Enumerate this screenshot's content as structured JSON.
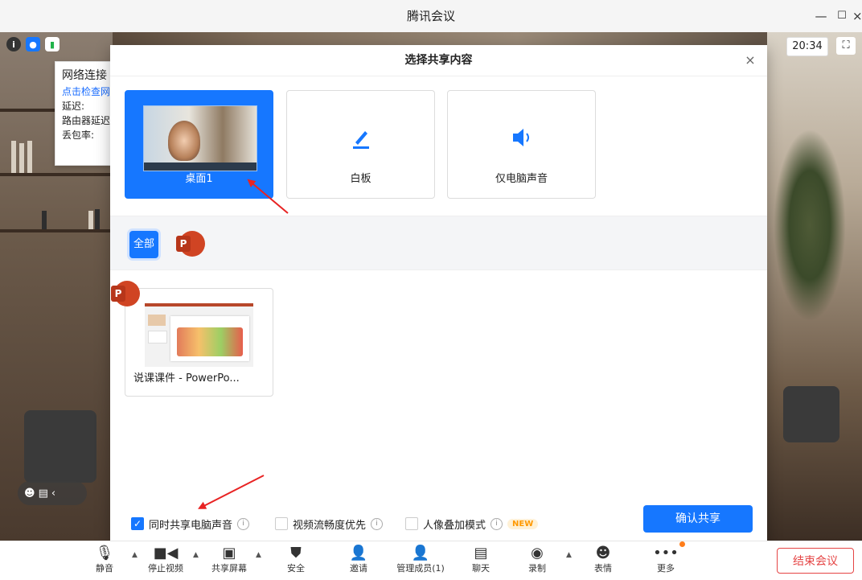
{
  "window": {
    "title": "腾讯会议",
    "minimize": "—",
    "maximize": "☐",
    "close": "×"
  },
  "network_popup": {
    "title": "网络连接",
    "link": "点击检查网",
    "latency": "延迟:",
    "router_latency": "路由器延迟",
    "packet_loss": "丢包率:"
  },
  "clock": "20:34",
  "dialog": {
    "title": "选择共享内容",
    "close": "×",
    "cards": [
      {
        "label": "桌面1",
        "icon": "desktop-thumbnail",
        "selected": true
      },
      {
        "label": "白板",
        "icon": "pen-icon",
        "selected": false
      },
      {
        "label": "仅电脑声音",
        "icon": "speaker-icon",
        "selected": false
      }
    ],
    "filter_all": "全部",
    "ppt_badge": "P",
    "app_card_label": "说课课件 - PowerPo...",
    "options": [
      {
        "label": "同时共享电脑声音",
        "checked": true
      },
      {
        "label": "视频流畅度优先",
        "checked": false
      },
      {
        "label": "人像叠加模式",
        "checked": false,
        "tag": "NEW"
      }
    ],
    "confirm": "确认共享"
  },
  "toolbar": {
    "items": [
      {
        "label": "静音",
        "icon": "mic-icon"
      },
      {
        "label": "停止视频",
        "icon": "camera-icon"
      },
      {
        "label": "共享屏幕",
        "icon": "share-screen-icon"
      },
      {
        "label": "安全",
        "icon": "shield-icon"
      },
      {
        "label": "邀请",
        "icon": "invite-icon"
      },
      {
        "label": "管理成员(1)",
        "icon": "members-icon"
      },
      {
        "label": "聊天",
        "icon": "chat-icon"
      },
      {
        "label": "录制",
        "icon": "record-icon"
      },
      {
        "label": "表情",
        "icon": "emoji-icon"
      },
      {
        "label": "更多",
        "icon": "more-icon"
      }
    ],
    "end_meeting": "结束会议"
  },
  "colors": {
    "accent": "#1677ff",
    "danger": "#e54545",
    "arrow": "#e82323"
  }
}
